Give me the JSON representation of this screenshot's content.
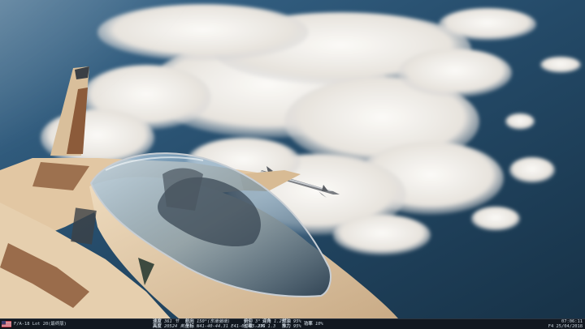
{
  "hud": {
    "aircraft": "F/A-18 Lot 20(最终版)",
    "speed_row": {
      "label": "速度",
      "value": "361 节"
    },
    "alt_row": {
      "label": "高度",
      "value": "20524 英尺"
    },
    "heading_row": {
      "label": "航向",
      "value": "150°(东南偏南)"
    },
    "coord_row": {
      "label": "坐标",
      "value": "N41-40-44.31 E41-05-15.27"
    },
    "pitch_row": {
      "label": "俯仰",
      "value": "3°"
    },
    "gload_row": {
      "label": "过载",
      "value": "-39°"
    },
    "aoa_row": {
      "label": "迎角",
      "value": "1.2°"
    },
    "gforce_row": {
      "label": "G",
      "value": "1.3"
    },
    "fuel_row": {
      "label": "燃油",
      "value": "95%"
    },
    "thrust_row": {
      "label": "推力",
      "value": "95%"
    },
    "power_row": {
      "label": "功率",
      "value": "10%"
    },
    "time": "07:06:11",
    "date": "F4 25/04/2018"
  },
  "colors": {
    "sky_top": "#f3f0ea",
    "ocean": "#1b3850",
    "cloud": "#f2f1ee",
    "jet_tan": "#e6cfae",
    "jet_brown": "#8c5b3a",
    "hud_bg": "#121820"
  },
  "icons": {
    "flag": "us-flag-icon",
    "missile": "missile"
  }
}
